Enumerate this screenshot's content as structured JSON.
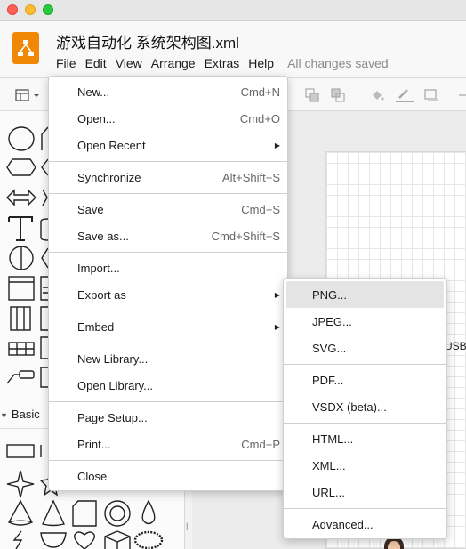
{
  "window": {
    "title": "游戏自动化 系统架构图.xml"
  },
  "menubar": {
    "items": [
      "File",
      "Edit",
      "View",
      "Arrange",
      "Extras",
      "Help"
    ],
    "status": "All changes saved"
  },
  "sidebar": {
    "section_label": "Basic"
  },
  "canvas": {
    "partial_label": "USB主"
  },
  "file_menu": {
    "new": {
      "label": "New...",
      "shortcut": "Cmd+N"
    },
    "open": {
      "label": "Open...",
      "shortcut": "Cmd+O"
    },
    "open_recent": {
      "label": "Open Recent"
    },
    "synchronize": {
      "label": "Synchronize",
      "shortcut": "Alt+Shift+S"
    },
    "save": {
      "label": "Save",
      "shortcut": "Cmd+S"
    },
    "save_as": {
      "label": "Save as...",
      "shortcut": "Cmd+Shift+S"
    },
    "import": {
      "label": "Import..."
    },
    "export_as": {
      "label": "Export as"
    },
    "embed": {
      "label": "Embed"
    },
    "new_library": {
      "label": "New Library..."
    },
    "open_library": {
      "label": "Open Library..."
    },
    "page_setup": {
      "label": "Page Setup..."
    },
    "print": {
      "label": "Print...",
      "shortcut": "Cmd+P"
    },
    "close": {
      "label": "Close"
    }
  },
  "export_menu": {
    "png": "PNG...",
    "jpeg": "JPEG...",
    "svg": "SVG...",
    "pdf": "PDF...",
    "vsdx": "VSDX (beta)...",
    "html": "HTML...",
    "xml": "XML...",
    "url": "URL...",
    "advanced": "Advanced..."
  },
  "colors": {
    "logo": "#f08705",
    "highlight": "#e4e4e4"
  }
}
